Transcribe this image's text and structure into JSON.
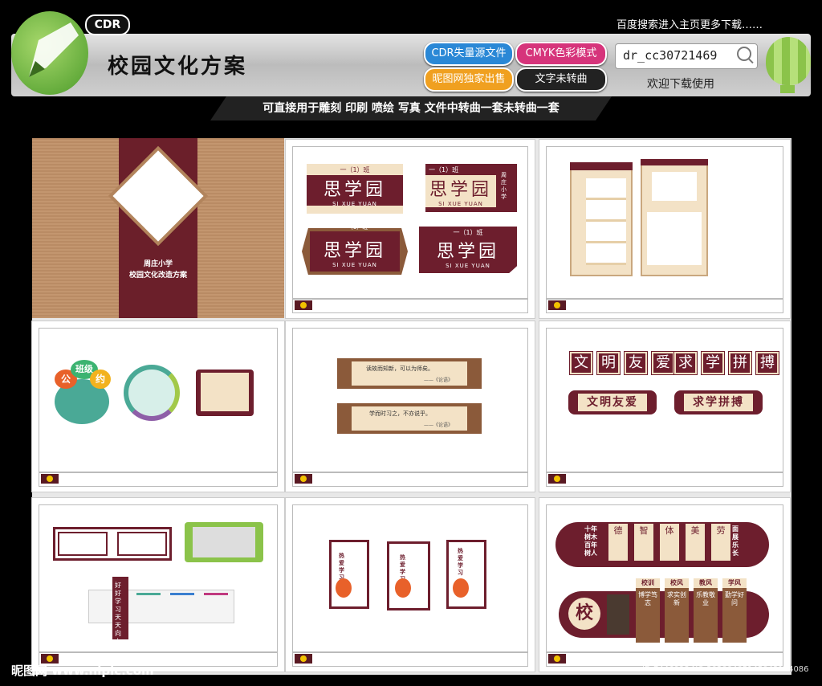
{
  "header": {
    "badge": "CDR",
    "title": "校园文化方案",
    "top_right": "百度搜索进入主页更多下载……",
    "pills": [
      "CDR失量源文件",
      "CMYK色彩模式",
      "昵图网独家出售",
      "文字未转曲"
    ],
    "search_value": "dr_cc30721469",
    "welcome": "欢迎下载使用",
    "subtitle": "可直接用于雕刻 印刷 喷绘 写真  文件中转曲一套未转曲一套"
  },
  "cover": {
    "line1": "周庄小学",
    "line2": "校园文化改造方案"
  },
  "signs": {
    "class": "一（1）班",
    "name": "思学园",
    "en": "SI XUE YUAN",
    "school_vertical": "周庄小学"
  },
  "circles": {
    "left_top": "班级",
    "left_chars": [
      "公",
      "约"
    ]
  },
  "calligraphy": {
    "row1a": "文明友爱",
    "row1b": "求学拼搏",
    "row2a": "文明友爱",
    "row2b": "求学拼搏"
  },
  "banners": [
    "读故而知新，可以为师矣。",
    "学而时习之，不亦说乎。"
  ],
  "banner_author": "——《论语》",
  "posters": {
    "label": "热爱学习"
  },
  "bottom_left": {
    "vertical": "好好学习天天向上"
  },
  "bottom_right": {
    "top_left_vertical": "十年树木百年树人",
    "top_right_vertical": "全面发展快乐成长",
    "top_cards": [
      "德",
      "智",
      "体",
      "美",
      "劳"
    ],
    "school_char": "校",
    "sections": [
      "校训",
      "校风",
      "教风",
      "学风"
    ],
    "section_texts": [
      "博学笃志",
      "求实创新",
      "乐教敬业",
      "勤学好问"
    ]
  },
  "watermark": {
    "left": "昵图网 www.nipic.com",
    "right": "ID:7446098 NO:20200405145043124086"
  },
  "colors": {
    "maroon": "#6d1e2d",
    "cream": "#f3e2c6",
    "brown": "#8b5a3a"
  }
}
